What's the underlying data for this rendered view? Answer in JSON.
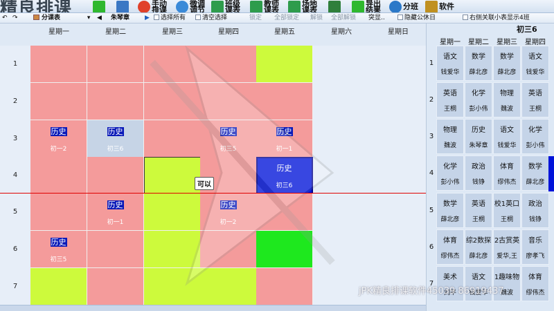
{
  "app": {
    "title": "精良排课"
  },
  "toolbar": [
    {
      "label": "",
      "icon": "add-icon",
      "color": "#2fb82f"
    },
    {
      "label": "",
      "icon": "open-icon",
      "color": "#3b78c4"
    },
    {
      "label": "手动排课",
      "icon": "color-wheel-icon",
      "color": "#e0402a"
    },
    {
      "label": "微调调节",
      "icon": "adjust-icon",
      "color": "#3a8ad8"
    },
    {
      "label": "班级课表",
      "icon": "class-table-icon",
      "color": "#2e9c4c"
    },
    {
      "label": "教师课表",
      "icon": "teacher-table-icon",
      "color": "#2e9c4c"
    },
    {
      "label": "场地课表",
      "icon": "room-table-icon",
      "color": "#2e9c4c"
    },
    {
      "label": "",
      "icon": "save-icon",
      "color": "#2f7f3b"
    },
    {
      "label": "导出结果",
      "icon": "export-icon",
      "color": "#2fb82f"
    },
    {
      "label": "分班",
      "icon": "globe-icon",
      "color": "#2a78c8"
    },
    {
      "label": "软件",
      "icon": "software-icon",
      "color": "#c09020"
    }
  ],
  "toolbar2": {
    "view_select": "分课表",
    "teacher": "朱琴章",
    "select_all": "选择所有",
    "clear_select": "清空选择",
    "lock": "锁定",
    "lock_all": "全部锁定",
    "unlock": "解锁",
    "unlock_all": "全部解锁",
    "highlight": "突显",
    "hide_common": "隐藏公休日",
    "right_display": "右侧关联小表显示4班"
  },
  "days": [
    "星期一",
    "星期二",
    "星期三",
    "星期四",
    "星期五",
    "星期六",
    "星期日"
  ],
  "periods": [
    "1",
    "2",
    "3",
    "4",
    "5",
    "6",
    "7"
  ],
  "grid": [
    [
      "pink",
      "pink",
      "pink",
      "pink",
      "lime"
    ],
    [
      "pink",
      "pink",
      "pink",
      "pink",
      "pink"
    ],
    [
      "pink",
      "grey",
      "pink",
      "pink",
      "pink"
    ],
    [
      "pink",
      "pink",
      "lime-sel",
      "pink",
      "blue"
    ],
    [
      "pink",
      "pink",
      "lime",
      "pink",
      "pink"
    ],
    [
      "pink",
      "pink",
      "lime",
      "pink",
      "green"
    ],
    [
      "lime",
      "pink",
      "lime",
      "lime",
      "pink"
    ]
  ],
  "lessons": [
    {
      "row": 2,
      "col": 0,
      "subject": "历史",
      "class": "初一2"
    },
    {
      "row": 2,
      "col": 1,
      "subject": "历史",
      "class": "初三6"
    },
    {
      "row": 2,
      "col": 3,
      "subject": "历史",
      "class": "初三5"
    },
    {
      "row": 2,
      "col": 4,
      "subject": "历史",
      "class": "初一1"
    },
    {
      "row": 3,
      "col": 4,
      "subject": "历史",
      "class": "初三6"
    },
    {
      "row": 4,
      "col": 1,
      "subject": "历史",
      "class": "初一1"
    },
    {
      "row": 4,
      "col": 3,
      "subject": "历史",
      "class": "初一2"
    },
    {
      "row": 5,
      "col": 0,
      "subject": "历史",
      "class": "初三5"
    }
  ],
  "tooltip": "可以",
  "right_panel": {
    "class_name": "初三6",
    "days": [
      "星期一",
      "星期二",
      "星期三",
      "星期四"
    ],
    "rows": [
      [
        {
          "s": "语文",
          "t": "钱爱华"
        },
        {
          "s": "数学",
          "t": "薛北彦"
        },
        {
          "s": "数学",
          "t": "薛北彦"
        },
        {
          "s": "语文",
          "t": "钱爱华"
        }
      ],
      [
        {
          "s": "英语",
          "t": "王桐"
        },
        {
          "s": "化学",
          "t": "彭小伟"
        },
        {
          "s": "物理",
          "t": "魏波"
        },
        {
          "s": "英语",
          "t": "王桐"
        }
      ],
      [
        {
          "s": "物理",
          "t": "魏波"
        },
        {
          "s": "历史",
          "t": "朱琴章"
        },
        {
          "s": "语文",
          "t": "钱爱华"
        },
        {
          "s": "化学",
          "t": "彭小伟"
        }
      ],
      [
        {
          "s": "化学",
          "t": "彭小伟"
        },
        {
          "s": "政治",
          "t": "钱铮"
        },
        {
          "s": "体育",
          "t": "缪伟杰"
        },
        {
          "s": "数学",
          "t": "薛北彦"
        }
      ],
      [
        {
          "s": "数学",
          "t": "薛北彦"
        },
        {
          "s": "英语",
          "t": "王桐"
        },
        {
          "s": "校1英口",
          "t": "王桐"
        },
        {
          "s": "政治",
          "t": "钱铮"
        }
      ],
      [
        {
          "s": "体育",
          "t": "缪伟杰"
        },
        {
          "s": "综2数探",
          "t": "薛北彦"
        },
        {
          "s": "2古赏英",
          "t": "爱华,王"
        },
        {
          "s": "音乐",
          "t": "廖孝飞"
        }
      ],
      [
        {
          "s": "美术",
          "t": "刘平"
        },
        {
          "s": "语文",
          "t": "钱爱华"
        },
        {
          "s": "1趣味物",
          "t": "魏波"
        },
        {
          "s": "体育",
          "t": "缪伟杰"
        }
      ]
    ]
  },
  "watermark": "jPK精良排课软件45039 86919437"
}
